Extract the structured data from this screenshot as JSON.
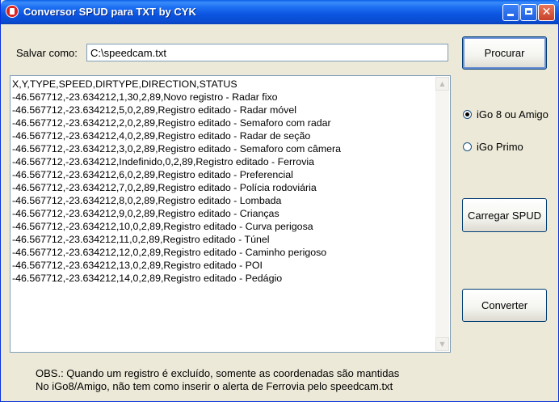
{
  "window": {
    "title": "Conversor SPUD para TXT by CYK"
  },
  "save": {
    "label": "Salvar como:",
    "value": "C:\\speedcam.txt"
  },
  "buttons": {
    "procurar": "Procurar",
    "carregar": "Carregar SPUD",
    "converter": "Converter"
  },
  "radios": [
    {
      "label": "iGo 8 ou Amigo",
      "checked": true
    },
    {
      "label": "iGo Primo",
      "checked": false
    }
  ],
  "output_lines": [
    "X,Y,TYPE,SPEED,DIRTYPE,DIRECTION,STATUS",
    "-46.567712,-23.634212,1,30,2,89,Novo registro - Radar fixo",
    "-46.567712,-23.634212,5,0,2,89,Registro editado - Radar móvel",
    "-46.567712,-23.634212,2,0,2,89,Registro editado - Semaforo com radar",
    "-46.567712,-23.634212,4,0,2,89,Registro editado - Radar de seção",
    "-46.567712,-23.634212,3,0,2,89,Registro editado - Semaforo com câmera",
    "-46.567712,-23.634212,Indefinido,0,2,89,Registro editado - Ferrovia",
    "-46.567712,-23.634212,6,0,2,89,Registro editado - Preferencial",
    "-46.567712,-23.634212,7,0,2,89,Registro editado - Polícia rodoviária",
    "-46.567712,-23.634212,8,0,2,89,Registro editado - Lombada",
    "-46.567712,-23.634212,9,0,2,89,Registro editado - Crianças",
    "-46.567712,-23.634212,10,0,2,89,Registro editado - Curva perigosa",
    "-46.567712,-23.634212,11,0,2,89,Registro editado - Túnel",
    "-46.567712,-23.634212,12,0,2,89,Registro editado - Caminho perigoso",
    "-46.567712,-23.634212,13,0,2,89,Registro editado - POI",
    "-46.567712,-23.634212,14,0,2,89,Registro editado - Pedágio"
  ],
  "notes": [
    "OBS.: Quando um registro é excluído, somente as coordenadas são mantidas",
    "No iGo8/Amigo, não tem como inserir o alerta de Ferrovia pelo speedcam.txt"
  ]
}
